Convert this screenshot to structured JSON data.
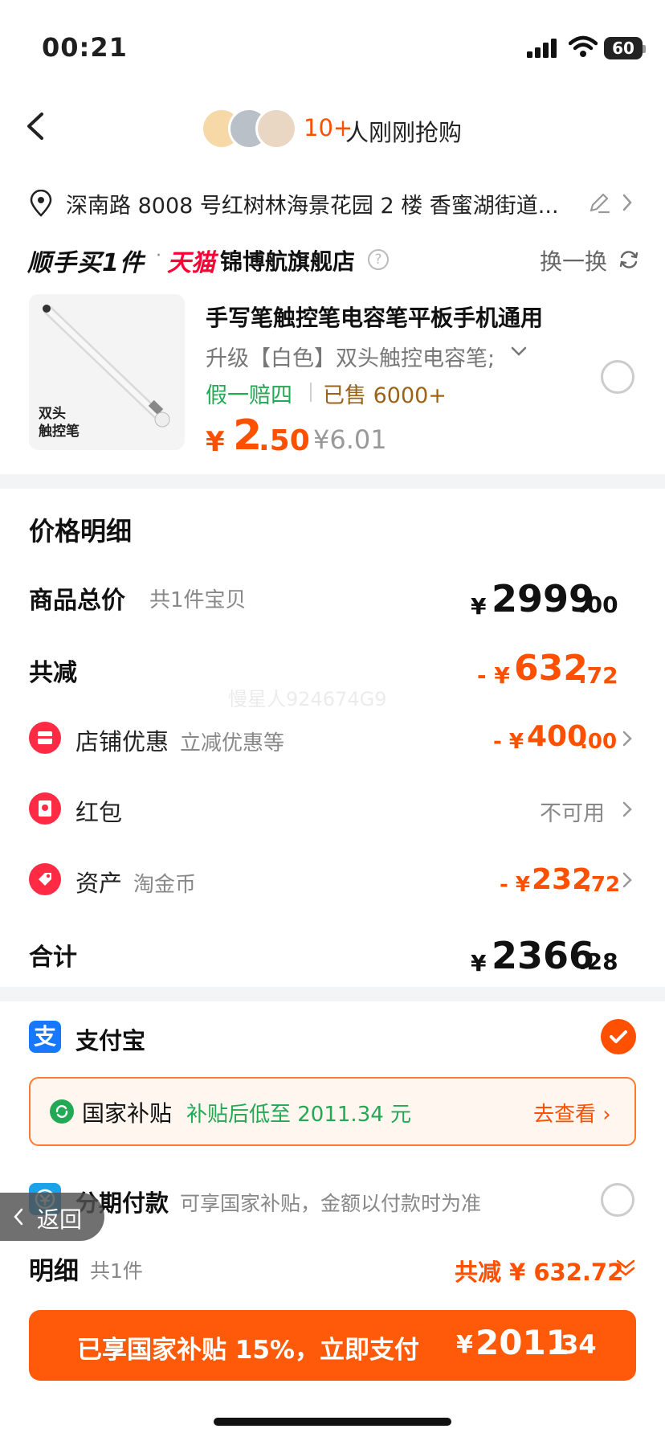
{
  "status_bar": {
    "time": "00:21",
    "battery": "60"
  },
  "header": {
    "hot_count": "10+",
    "hot_text": "人刚刚抢购"
  },
  "address": {
    "text": "深南路 8008 号红树林海景花园 2 楼 香蜜湖街道..."
  },
  "store": {
    "brand": "顺手买1件",
    "dot": "·",
    "tmall": "天猫",
    "name": "锦博航旗舰店",
    "help": "?",
    "swap_label": "换一换"
  },
  "product": {
    "image_label_line1": "双头",
    "image_label_line2": "触控笔",
    "title": "手写笔触控笔电容笔平板手机通用",
    "spec": "升级【白色】双头触控电容笔;",
    "guarantee": "假一赔四",
    "sold": "已售 6000+",
    "currency": "¥",
    "price_int": "2",
    "price_dec": ".50",
    "original_price": "¥6.01"
  },
  "price_detail": {
    "title": "价格明细",
    "total": {
      "label": "商品总价",
      "sub": "共1件宝贝",
      "currency": "¥",
      "int": "2999",
      "dec": ".00"
    },
    "discount": {
      "label": "共减",
      "prefix": "- ¥",
      "int": "632",
      "dec": ".72"
    },
    "store_coupon": {
      "label": "店铺优惠",
      "sub": "立减优惠等",
      "prefix": "- ¥",
      "int": "400",
      "dec": ".00"
    },
    "red_packet": {
      "label": "红包",
      "value": "不可用"
    },
    "assets": {
      "label": "资产",
      "sub": "淘金币",
      "prefix": "- ¥",
      "int": "232",
      "dec": ".72"
    },
    "sum": {
      "label": "合计",
      "currency": "¥",
      "int": "2366",
      "dec": ".28"
    },
    "watermark": "慢星人924674G9"
  },
  "payment": {
    "alipay_label": "支付宝",
    "alipay_icon": "支",
    "subsidy_label": "国家补贴",
    "subsidy_desc": "补贴后低至 2011.34 元",
    "subsidy_link": "去查看 ›",
    "installment_label": "分期付款",
    "installment_desc": "可享国家补贴，金额以付款时为准"
  },
  "float_back": {
    "label": "返回"
  },
  "detail": {
    "label": "明细",
    "count": "共1件",
    "discount": "共减 ¥ 632.72"
  },
  "pay_button": {
    "text": "已享国家补贴 15%，立即支付",
    "currency": "¥",
    "int": "2011",
    "dec": ".34"
  },
  "colors": {
    "accent": "#ff5000",
    "green": "#23a855",
    "alipay": "#1677ff",
    "tmall": "#ff0036"
  },
  "icons": [
    "back-chevron-icon",
    "location-icon",
    "edit-icon",
    "refresh-icon",
    "store-coupon-icon",
    "red-packet-icon",
    "assets-tag-icon",
    "alipay-icon",
    "check-icon",
    "subsidy-icon",
    "installment-icon"
  ]
}
